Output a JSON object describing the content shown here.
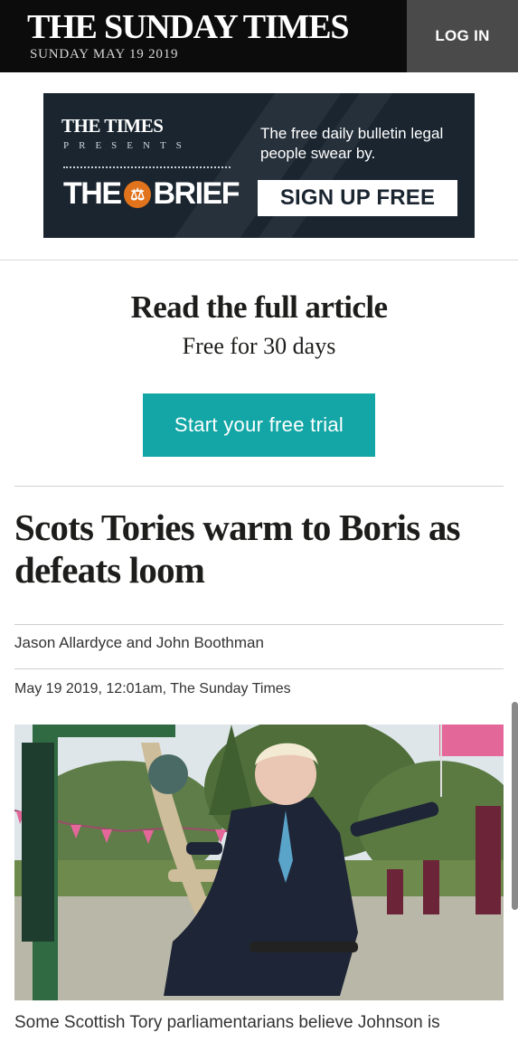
{
  "header": {
    "masthead": "THE SUNDAY TIMES",
    "date": "SUNDAY MAY 19 2019",
    "login_label": "LOG IN"
  },
  "ad": {
    "times_logo": "THE TIMES",
    "presents": "PRESENTS",
    "brand_left": "THE",
    "brand_right": "BRIEF",
    "tagline": "The free daily bulletin legal people swear by.",
    "cta_label": "SIGN UP FREE"
  },
  "paywall": {
    "title": "Read the full article",
    "subtitle": "Free for 30 days",
    "cta_label": "Start your free trial"
  },
  "article": {
    "headline": "Scots Tories warm to Boris as defeats loom",
    "byline": "Jason Allardyce and John Boothman",
    "dateline": "May 19 2019, 12:01am, The Sunday Times",
    "caption": "Some Scottish Tory parliamentarians believe Johnson is"
  },
  "colors": {
    "header_bg": "#0c0c0c",
    "login_bg": "#4a4a4a",
    "cta_bg": "#14a6a6",
    "ad_bg": "#1a2530",
    "ad_badge": "#e0731c"
  }
}
